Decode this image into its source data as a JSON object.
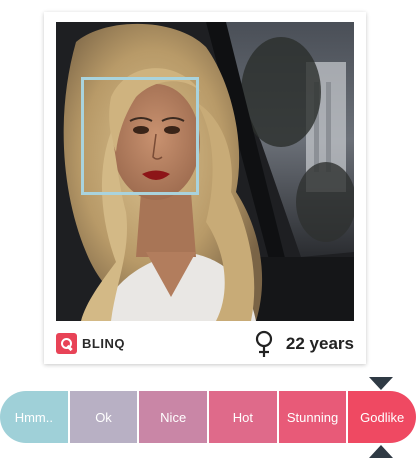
{
  "card": {
    "brand_name": "BLINQ",
    "brand_icon": "blinq-search-logo-icon",
    "gender_icon": "female-symbol-icon",
    "age_label": "22 years"
  },
  "rating_scale": {
    "options": [
      "Hmm..",
      "Ok",
      "Nice",
      "Hot",
      "Stunning",
      "Godlike"
    ],
    "selected": "Godlike",
    "colors": [
      "#9fd0d8",
      "#b8b0c4",
      "#c986a6",
      "#df6a8a",
      "#e85a78",
      "#ef4962"
    ]
  },
  "colors": {
    "face_box": "#a9d3dd",
    "pointer": "#2f3a44",
    "brand": "#e84357"
  }
}
